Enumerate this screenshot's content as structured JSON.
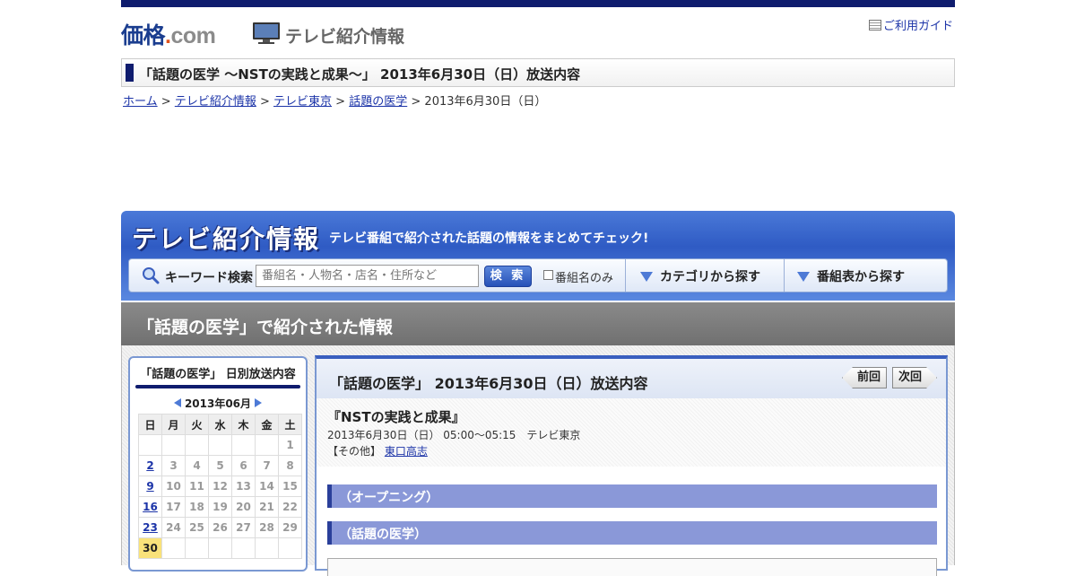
{
  "site": {
    "logo_main": "価格",
    "logo_dot": ".",
    "logo_com": "com",
    "section_name": "テレビ紹介情報",
    "guide_link": "ご利用ガイド"
  },
  "page": {
    "title": "「話題の医学 ～NSTの実践と成果～」 2013年6月30日（日）放送内容"
  },
  "breadcrumb": {
    "items": [
      "ホーム",
      "テレビ紹介情報",
      "テレビ東京",
      "話題の医学"
    ],
    "separator": ">",
    "current": "2013年6月30日（日）"
  },
  "banner": {
    "logo": "テレビ紹介情報",
    "tagline": "テレビ番組で紹介された話題の情報をまとめてチェック!",
    "keyword_label": "キーワード検索",
    "search_placeholder": "番組名・人物名・店名・住所など",
    "search_button": "検 索",
    "checkbox_label": "番組名のみ",
    "category_label": "カテゴリから探す",
    "schedule_label": "番組表から探す"
  },
  "section": {
    "heading": "「話題の医学」で紹介された情報"
  },
  "sidebar": {
    "title": "「話題の医学」 日別放送内容",
    "month": "2013年06月",
    "weekdays": [
      "日",
      "月",
      "火",
      "水",
      "木",
      "金",
      "土"
    ],
    "weeks": [
      [
        "",
        "",
        "",
        "",
        "",
        "",
        "1"
      ],
      [
        "2",
        "3",
        "4",
        "5",
        "6",
        "7",
        "8"
      ],
      [
        "9",
        "10",
        "11",
        "12",
        "13",
        "14",
        "15"
      ],
      [
        "16",
        "17",
        "18",
        "19",
        "20",
        "21",
        "22"
      ],
      [
        "23",
        "24",
        "25",
        "26",
        "27",
        "28",
        "29"
      ],
      [
        "30",
        "",
        "",
        "",
        "",
        "",
        ""
      ]
    ],
    "linked_days": [
      "2",
      "9",
      "16",
      "23"
    ],
    "current_day": "30"
  },
  "main": {
    "heading": "「話題の医学」 2013年6月30日（日）放送内容",
    "prev_label": "前回",
    "next_label": "次回",
    "episode_title": "『NSTの実践と成果』",
    "episode_info": "2013年6月30日（日） 05:00～05:15　テレビ東京",
    "other_label": "【その他】",
    "other_person": "東口高志",
    "corners": [
      "（オープニング）",
      "（話題の医学）"
    ]
  },
  "colors": {
    "brand_navy": "#0f1c6e",
    "link": "#1c34a8",
    "banner_blue": "#2f5bc4",
    "corner_bar": "#8a98d8",
    "today_highlight": "#f9e27a"
  }
}
